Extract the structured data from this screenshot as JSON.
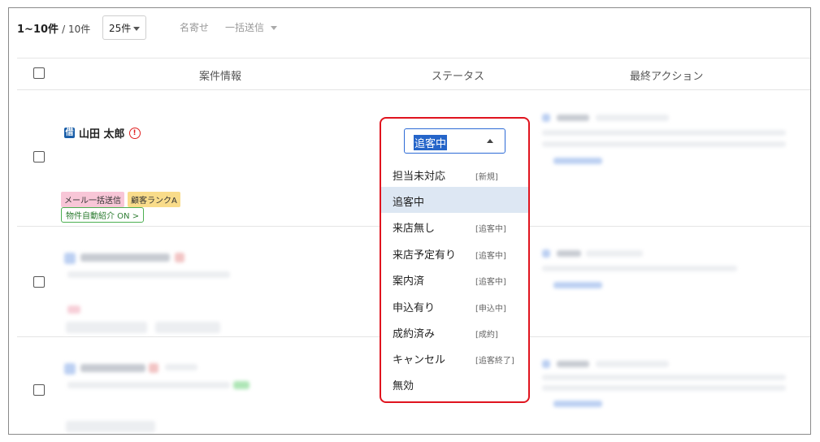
{
  "toolbar": {
    "range": "1~10件",
    "total": "/ 10件",
    "per_page": "25件",
    "nayose": "名寄せ",
    "bulk_send": "一括送信"
  },
  "table": {
    "headers": [
      "案件情報",
      "ステータス",
      "最終アクション"
    ]
  },
  "row1": {
    "badge": "借",
    "name": "山田 太郎",
    "warn": "!",
    "tags": [
      "メール一括送信",
      "顧客ランクA"
    ],
    "auto_intro": "物件自動紹介 ON >"
  },
  "status_dropdown": {
    "current": "追客中",
    "options": [
      {
        "label": "担当未対応",
        "sub": "[新規]"
      },
      {
        "label": "追客中",
        "sub": ""
      },
      {
        "label": "来店無し",
        "sub": "[追客中]"
      },
      {
        "label": "来店予定有り",
        "sub": "[追客中]"
      },
      {
        "label": "案内済",
        "sub": "[追客中]"
      },
      {
        "label": "申込有り",
        "sub": "[申込中]"
      },
      {
        "label": "成約済み",
        "sub": "[成約]"
      },
      {
        "label": "キャンセル",
        "sub": "[追客終了]"
      },
      {
        "label": "無効",
        "sub": ""
      }
    ],
    "selected_index": 1
  },
  "colors": {
    "highlight_border": "#e0141e",
    "select_border": "#2d6bd6",
    "selected_option_bg": "#dde7f3"
  }
}
